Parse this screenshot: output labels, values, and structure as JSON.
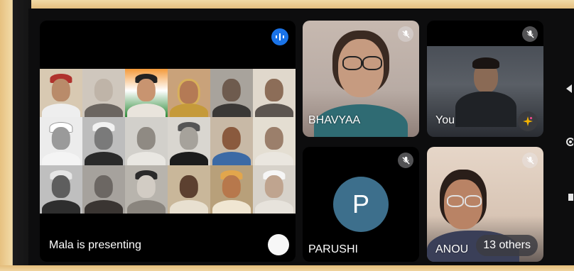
{
  "presentation": {
    "caption": "Mala is presenting"
  },
  "participants": [
    {
      "name": "BHAVYAA"
    },
    {
      "name": "You"
    },
    {
      "name": "PARUSHI",
      "initial": "P"
    },
    {
      "name": "ANOUSHKA",
      "name_visible": "ANOU"
    }
  ],
  "others_count_label": "13 others",
  "colors": {
    "background": "#0d0d0e",
    "tile": "#2b2c30",
    "accent": "#1a73e8",
    "avatar": "#3d6f8c"
  },
  "icons": [
    "mic-off-icon",
    "audio-wave-icon",
    "sparkle-icon",
    "chevron-left-icon"
  ]
}
